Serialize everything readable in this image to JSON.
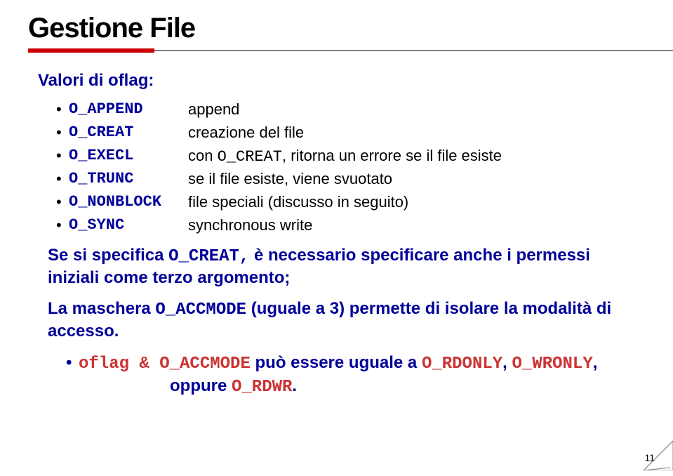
{
  "title": "Gestione File",
  "heading": "Valori di oflag:",
  "flags": [
    {
      "name": "O_APPEND",
      "desc_prefix": "",
      "desc_mono": "",
      "desc_suffix": "append"
    },
    {
      "name": "O_CREAT",
      "desc_prefix": "",
      "desc_mono": "",
      "desc_suffix": "creazione del file"
    },
    {
      "name": "O_EXECL",
      "desc_prefix": "con ",
      "desc_mono": "O_CREAT",
      "desc_suffix": ", ritorna un errore se il file esiste"
    },
    {
      "name": "O_TRUNC",
      "desc_prefix": "",
      "desc_mono": "",
      "desc_suffix": "se il file esiste, viene svuotato"
    },
    {
      "name": "O_NONBLOCK",
      "desc_prefix": "",
      "desc_mono": "",
      "desc_suffix": "file speciali (discusso in seguito)"
    },
    {
      "name": "O_SYNC",
      "desc_prefix": "",
      "desc_mono": "",
      "desc_suffix": "synchronous write"
    }
  ],
  "para1_a": "Se si specifica ",
  "para1_mono": "O_CREAT,",
  "para1_b": " è necessario specificare anche i permessi iniziali come terzo argomento;",
  "para2_a": "La maschera ",
  "para2_mono": "O_ACCMODE",
  "para2_b": " (uguale a 3) permette di isolare la modalità di accesso.",
  "last_a": "oflag & O_ACCMODE",
  "last_b": " può essere uguale a ",
  "last_c": "O_RDONLY",
  "last_d": ", ",
  "last_e": "O_WRONLY",
  "last_f": ",",
  "last_g": "oppure ",
  "last_h": "O_RDWR",
  "last_i": ".",
  "page": "11"
}
